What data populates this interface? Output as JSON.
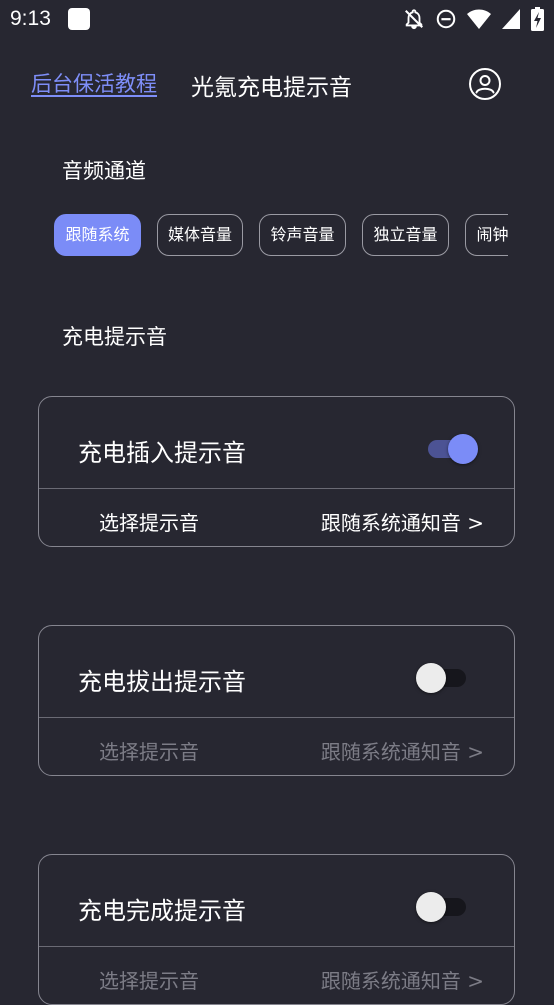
{
  "status_bar": {
    "time": "9:13",
    "icons": [
      "app-notification-icon",
      "notifications-off-icon",
      "do-not-disturb-icon",
      "wifi-icon",
      "signal-icon",
      "battery-charging-icon"
    ]
  },
  "header": {
    "link_label": "后台保活教程",
    "title": "光氪充电提示音",
    "account_icon": "account-icon"
  },
  "audio_channel": {
    "label": "音频通道",
    "options": [
      {
        "label": "跟随系统",
        "selected": true
      },
      {
        "label": "媒体音量",
        "selected": false
      },
      {
        "label": "铃声音量",
        "selected": false
      },
      {
        "label": "独立音量",
        "selected": false
      },
      {
        "label": "闹钟音量",
        "selected": false
      }
    ]
  },
  "charging_sounds": {
    "label": "充电提示音",
    "cards": [
      {
        "title": "充电插入提示音",
        "enabled": true,
        "select_label": "选择提示音",
        "select_value": "跟随系统通知音 >"
      },
      {
        "title": "充电拔出提示音",
        "enabled": false,
        "select_label": "选择提示音",
        "select_value": "跟随系统通知音 >"
      },
      {
        "title": "充电完成提示音",
        "enabled": false,
        "select_label": "选择提示音",
        "select_value": "跟随系统通知音 >"
      }
    ]
  },
  "colors": {
    "background": "#272731",
    "accent": "#7b8cf7",
    "link": "#7e8ef8",
    "text": "#ffffff",
    "disabled_text": "#7c7c86"
  }
}
